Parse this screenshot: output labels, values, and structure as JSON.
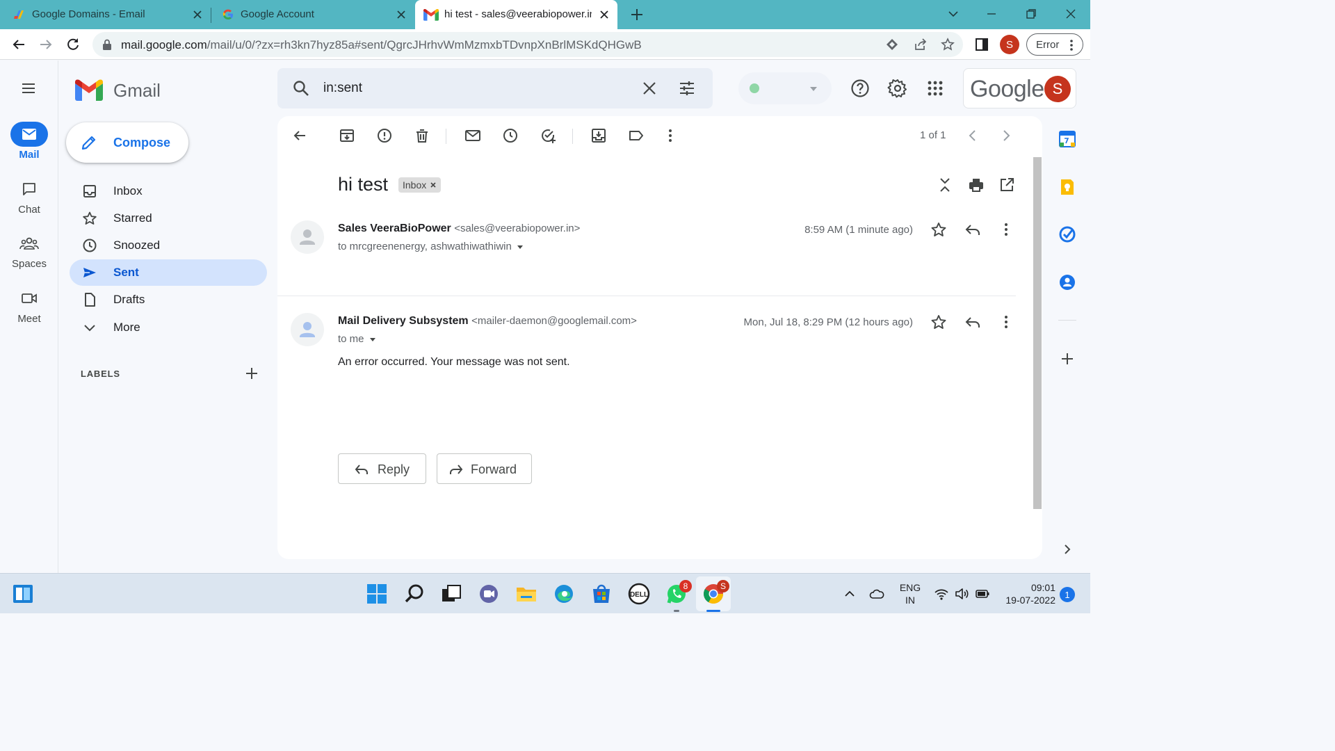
{
  "browser": {
    "tabs": [
      {
        "title": "Google Domains - Email",
        "active": false
      },
      {
        "title": "Google Account",
        "active": false
      },
      {
        "title": "hi test - sales@veerabiopower.in",
        "active": true
      }
    ],
    "url_host": "mail.google.com",
    "url_path": "/mail/u/0/?zx=rh3kn7hyz85a#sent/QgrcJHrhvWmMzmxbTDvnpXnBrlMSKdQHGwB",
    "profile_initial": "S",
    "error_label": "Error"
  },
  "gmail": {
    "app_name": "Gmail",
    "rail": [
      {
        "label": "Mail",
        "icon": "mail-icon",
        "active": true
      },
      {
        "label": "Chat",
        "icon": "chat-icon",
        "active": false
      },
      {
        "label": "Spaces",
        "icon": "spaces-icon",
        "active": false
      },
      {
        "label": "Meet",
        "icon": "meet-icon",
        "active": false
      }
    ],
    "compose_label": "Compose",
    "nav": [
      {
        "label": "Inbox",
        "icon": "inbox-icon",
        "active": false
      },
      {
        "label": "Starred",
        "icon": "star-icon",
        "active": false
      },
      {
        "label": "Snoozed",
        "icon": "clock-icon",
        "active": false
      },
      {
        "label": "Sent",
        "icon": "send-icon",
        "active": true
      },
      {
        "label": "Drafts",
        "icon": "draft-icon",
        "active": false
      },
      {
        "label": "More",
        "icon": "chevron-down-icon",
        "active": false
      }
    ],
    "labels_heading": "LABELS",
    "search": {
      "value": "in:sent"
    },
    "google_wordmark": "Google",
    "account_initial": "S",
    "colors": {
      "accent": "#1a73e8",
      "nav_active_bg": "#d3e3fd",
      "avatar": "#c5341d"
    }
  },
  "thread": {
    "pager": "1 of 1",
    "subject": "hi test",
    "label_chip": "Inbox",
    "messages": [
      {
        "sender_name": "Sales VeeraBioPower",
        "sender_email": "<sales@veerabiopower.in>",
        "recipients": "to mrcgreenenergy, ashwathiwathiwin",
        "time": "8:59 AM (1 minute ago)",
        "body": ""
      },
      {
        "sender_name": "Mail Delivery Subsystem",
        "sender_email": "<mailer-daemon@googlemail.com>",
        "recipients": "to me",
        "time": "Mon, Jul 18, 8:29 PM (12 hours ago)",
        "body": "An error occurred. Your message was not sent."
      }
    ],
    "reply_label": "Reply",
    "forward_label": "Forward"
  },
  "taskbar": {
    "whatsapp_badge": "8",
    "chrome_badge": "S",
    "lang_line1": "ENG",
    "lang_line2": "IN",
    "time": "09:01",
    "date": "19-07-2022",
    "notification_count": "1"
  }
}
